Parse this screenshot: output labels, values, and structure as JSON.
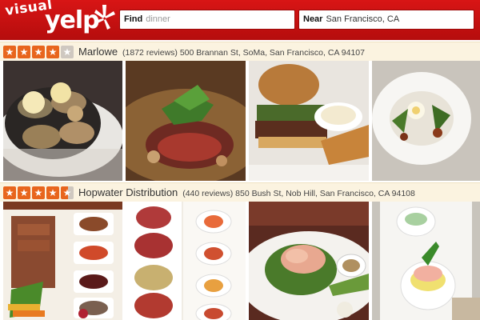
{
  "app": {
    "logo_visual": "visual",
    "logo_yelp": "yelp",
    "brand_color": "#d32323"
  },
  "search": {
    "find_label": "Find",
    "find_placeholder": "dinner",
    "near_label": "Near",
    "near_value": "San Francisco, CA"
  },
  "listings": [
    {
      "stars": [
        "★",
        "★",
        "★",
        "★",
        "★"
      ],
      "rating": 4,
      "name": "Marlowe",
      "reviews": "(1872 reviews)",
      "address": "500 Brannan St, SoMa, San Francisco, CA 94107",
      "photos": [
        {
          "subject": "grilled oysters on ice with lemon"
        },
        {
          "subject": "sliced steak with greens"
        },
        {
          "subject": "burger with fries and aioli"
        },
        {
          "subject": "salad with egg in white bowl"
        }
      ]
    },
    {
      "stars": [
        "★",
        "★",
        "★",
        "★",
        "★"
      ],
      "rating": 4.5,
      "name": "Hopwater Distribution",
      "reviews": "(440 reviews)",
      "address": "850 Bush St, Nob Hill, San Francisco, CA 94108",
      "photos": [
        {
          "subject": "charcuterie board with dips"
        },
        {
          "subject": "deviled eggs platter"
        },
        {
          "subject": "crab salad with asparagus"
        },
        {
          "subject": "deviled egg with shrimp"
        }
      ]
    }
  ]
}
